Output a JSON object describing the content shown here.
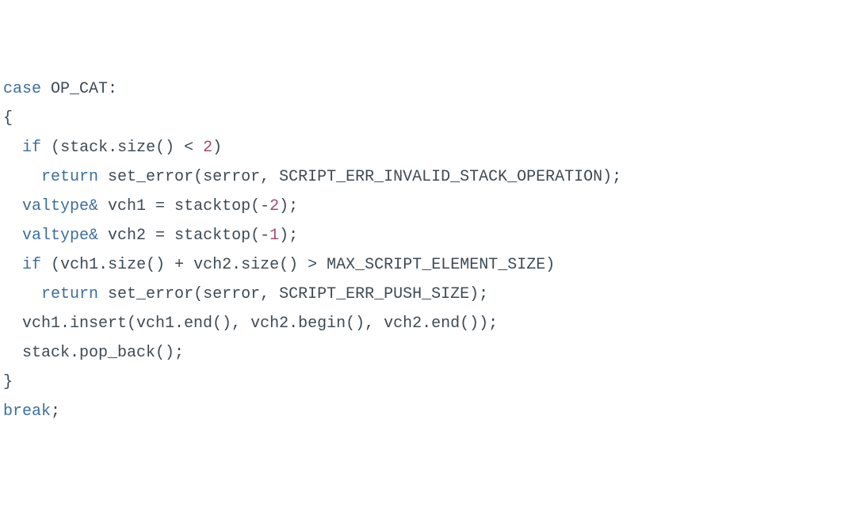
{
  "code": {
    "kw_case": "case",
    "OP_CAT": "OP_CAT",
    "lbrace": "{",
    "kw_if": "if",
    "stack_size_call": "stack.size()",
    "lt": "<",
    "num_2": "2",
    "kw_return": "return",
    "set_error_call1": "set_error(serror, SCRIPT_ERR_INVALID_STACK_OPERATION);",
    "valtype_amp": "valtype&",
    "vch1_assign": "vch1 = stacktop(-",
    "num_2b": "2",
    "close_paren_semi": ");",
    "vch2_assign": "vch2 = stacktop(-",
    "num_1": "1",
    "vch1_size_plus_vch2_size": "vch1.size() + vch2.size()",
    "gt": ">",
    "max_script_elem": "MAX_SCRIPT_ELEMENT_SIZE",
    "set_error_call2": "set_error(serror, SCRIPT_ERR_PUSH_SIZE);",
    "insert_call": "vch1.insert(vch1.end(), vch2.begin(), vch2.end());",
    "pop_back_call": "stack.pop_back();",
    "rbrace": "}",
    "kw_break": "break",
    "semi": ";",
    "colon": ":",
    "lparen": "(",
    "rparen": ")",
    "space": " "
  }
}
